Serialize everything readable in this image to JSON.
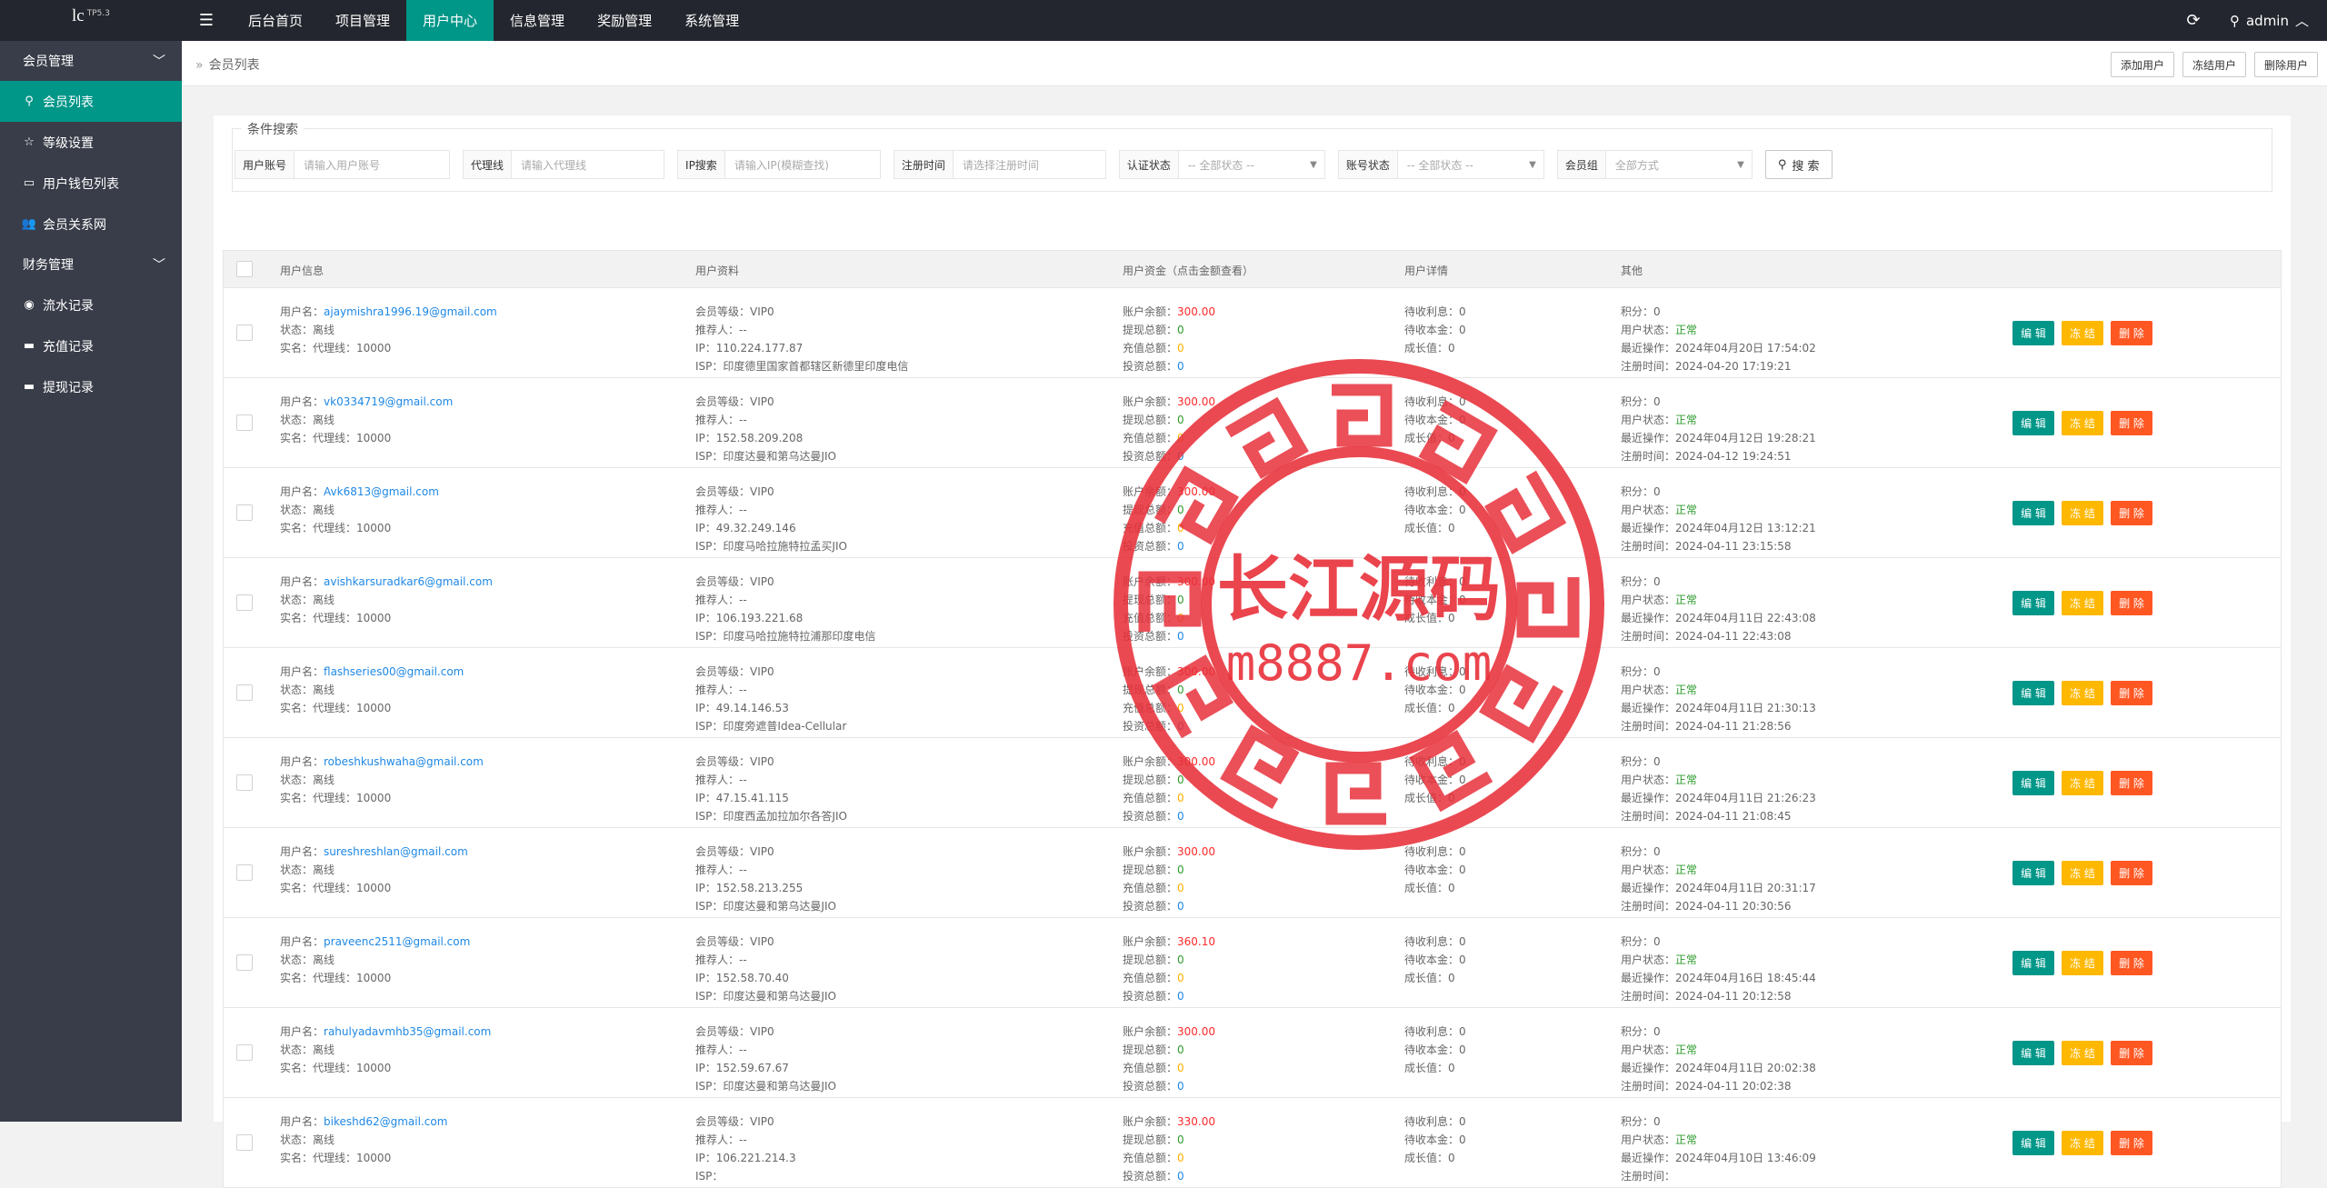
{
  "logo": {
    "main": "lc",
    "sup": "TP5.3"
  },
  "topnav": [
    {
      "label": "后台首页",
      "active": false
    },
    {
      "label": "项目管理",
      "active": false
    },
    {
      "label": "用户中心",
      "active": true
    },
    {
      "label": "信息管理",
      "active": false
    },
    {
      "label": "奖励管理",
      "active": false
    },
    {
      "label": "系统管理",
      "active": false
    }
  ],
  "admin": {
    "name": "admin"
  },
  "sidebar": {
    "group1": "会员管理",
    "items1": [
      {
        "label": "会员列表",
        "icon": "user-icon",
        "glyph": "⚲"
      },
      {
        "label": "等级设置",
        "icon": "star-icon",
        "glyph": "☆"
      },
      {
        "label": "用户钱包列表",
        "icon": "wallet-icon",
        "glyph": "▭"
      },
      {
        "label": "会员关系网",
        "icon": "users-icon",
        "glyph": "👥"
      }
    ],
    "group2": "财务管理",
    "items2": [
      {
        "label": "流水记录",
        "icon": "record-icon",
        "glyph": "◉"
      },
      {
        "label": "充值记录",
        "icon": "card-icon",
        "glyph": "▬"
      },
      {
        "label": "提现记录",
        "icon": "withdraw-icon",
        "glyph": "▬"
      }
    ]
  },
  "breadcrumb": {
    "sep": "»",
    "title": "会员列表"
  },
  "top_buttons": {
    "add": "添加用户",
    "freeze": "冻结用户",
    "delete": "删除用户"
  },
  "search": {
    "legend": "条件搜索",
    "username": {
      "label": "用户账号",
      "placeholder": "请输入用户账号"
    },
    "agent": {
      "label": "代理线",
      "placeholder": "请输入代理线"
    },
    "ip": {
      "label": "IP搜索",
      "placeholder": "请输入IP(模糊查找)"
    },
    "regtime": {
      "label": "注册时间",
      "placeholder": "请选择注册时间"
    },
    "auth": {
      "label": "认证状态",
      "value": "-- 全部状态 --"
    },
    "account": {
      "label": "账号状态",
      "value": "-- 全部状态 --"
    },
    "group": {
      "label": "会员组",
      "value": "全部方式"
    },
    "button": "搜 索"
  },
  "table": {
    "headers": {
      "info": "用户信息",
      "profile": "用户资料",
      "funds": "用户资金（点击金额查看）",
      "detail": "用户详情",
      "other": "其他"
    },
    "labels": {
      "username": "用户名：",
      "status": "状态：",
      "realname": "实名：",
      "agentline": "代理线：",
      "level": "会员等级：",
      "referrer": "推荐人：",
      "ip": "IP：",
      "isp": "ISP：",
      "balance": "账户余额：",
      "withdraw": "提现总额：",
      "recharge": "充值总额：",
      "invest": "投资总额：",
      "pending_interest": "待收利息：",
      "pending_principal": "待收本金：",
      "growth": "成长值：",
      "points": "积分：",
      "user_status": "用户状态：",
      "last_op": "最近操作：",
      "reg_time": "注册时间："
    },
    "ops": {
      "edit": "编 辑",
      "freeze": "冻 结",
      "delete": "删 除"
    },
    "rows": [
      {
        "username": "ajaymishra1996.19@gmail.com",
        "status": "离线",
        "agentline": "10000",
        "level": "VIP0",
        "referrer": "--",
        "ip": "110.224.177.87",
        "isp": "印度德里国家首都辖区新德里印度电信",
        "balance": "300.00",
        "withdraw": "0",
        "recharge": "0",
        "invest": "0",
        "pending_interest": "0",
        "pending_principal": "0",
        "growth": "0",
        "points": "0",
        "user_status": "正常",
        "last_op": "2024年04月20日 17:54:02",
        "reg_time": "2024-04-20 17:19:21"
      },
      {
        "username": "vk0334719@gmail.com",
        "status": "离线",
        "agentline": "10000",
        "level": "VIP0",
        "referrer": "--",
        "ip": "152.58.209.208",
        "isp": "印度达曼和第乌达曼JIO",
        "balance": "300.00",
        "withdraw": "0",
        "recharge": "0",
        "invest": "0",
        "pending_interest": "0",
        "pending_principal": "0",
        "growth": "0",
        "points": "0",
        "user_status": "正常",
        "last_op": "2024年04月12日 19:28:21",
        "reg_time": "2024-04-12 19:24:51"
      },
      {
        "username": "Avk6813@gmail.com",
        "status": "离线",
        "agentline": "10000",
        "level": "VIP0",
        "referrer": "--",
        "ip": "49.32.249.146",
        "isp": "印度马哈拉施特拉孟买JIO",
        "balance": "300.00",
        "withdraw": "0",
        "recharge": "0",
        "invest": "0",
        "pending_interest": "0",
        "pending_principal": "0",
        "growth": "0",
        "points": "0",
        "user_status": "正常",
        "last_op": "2024年04月12日 13:12:21",
        "reg_time": "2024-04-11 23:15:58"
      },
      {
        "username": "avishkarsuradkar6@gmail.com",
        "status": "离线",
        "agentline": "10000",
        "level": "VIP0",
        "referrer": "--",
        "ip": "106.193.221.68",
        "isp": "印度马哈拉施特拉浦那印度电信",
        "balance": "300.00",
        "withdraw": "0",
        "recharge": "0",
        "invest": "0",
        "pending_interest": "0",
        "pending_principal": "0",
        "growth": "0",
        "points": "0",
        "user_status": "正常",
        "last_op": "2024年04月11日 22:43:08",
        "reg_time": "2024-04-11 22:43:08"
      },
      {
        "username": "flashseries00@gmail.com",
        "status": "离线",
        "agentline": "10000",
        "level": "VIP0",
        "referrer": "--",
        "ip": "49.14.146.53",
        "isp": "印度旁遮普Idea-Cellular",
        "balance": "300.00",
        "withdraw": "0",
        "recharge": "0",
        "invest": "0",
        "pending_interest": "0",
        "pending_principal": "0",
        "growth": "0",
        "points": "0",
        "user_status": "正常",
        "last_op": "2024年04月11日 21:30:13",
        "reg_time": "2024-04-11 21:28:56"
      },
      {
        "username": "robeshkushwaha@gmail.com",
        "status": "离线",
        "agentline": "10000",
        "level": "VIP0",
        "referrer": "--",
        "ip": "47.15.41.115",
        "isp": "印度西孟加拉加尔各答JIO",
        "balance": "300.00",
        "withdraw": "0",
        "recharge": "0",
        "invest": "0",
        "pending_interest": "0",
        "pending_principal": "0",
        "growth": "0",
        "points": "0",
        "user_status": "正常",
        "last_op": "2024年04月11日 21:26:23",
        "reg_time": "2024-04-11 21:08:45"
      },
      {
        "username": "sureshreshlan@gmail.com",
        "status": "离线",
        "agentline": "10000",
        "level": "VIP0",
        "referrer": "--",
        "ip": "152.58.213.255",
        "isp": "印度达曼和第乌达曼JIO",
        "balance": "300.00",
        "withdraw": "0",
        "recharge": "0",
        "invest": "0",
        "pending_interest": "0",
        "pending_principal": "0",
        "growth": "0",
        "points": "0",
        "user_status": "正常",
        "last_op": "2024年04月11日 20:31:17",
        "reg_time": "2024-04-11 20:30:56"
      },
      {
        "username": "praveenc2511@gmail.com",
        "status": "离线",
        "agentline": "10000",
        "level": "VIP0",
        "referrer": "--",
        "ip": "152.58.70.40",
        "isp": "印度达曼和第乌达曼JIO",
        "balance": "360.10",
        "withdraw": "0",
        "recharge": "0",
        "invest": "0",
        "pending_interest": "0",
        "pending_principal": "0",
        "growth": "0",
        "points": "0",
        "user_status": "正常",
        "last_op": "2024年04月16日 18:45:44",
        "reg_time": "2024-04-11 20:12:58"
      },
      {
        "username": "rahulyadavmhb35@gmail.com",
        "status": "离线",
        "agentline": "10000",
        "level": "VIP0",
        "referrer": "--",
        "ip": "152.59.67.67",
        "isp": "印度达曼和第乌达曼JIO",
        "balance": "300.00",
        "withdraw": "0",
        "recharge": "0",
        "invest": "0",
        "pending_interest": "0",
        "pending_principal": "0",
        "growth": "0",
        "points": "0",
        "user_status": "正常",
        "last_op": "2024年04月11日 20:02:38",
        "reg_time": "2024-04-11 20:02:38"
      },
      {
        "username": "bikeshd62@gmail.com",
        "status": "离线",
        "agentline": "10000",
        "level": "VIP0",
        "referrer": "--",
        "ip": "106.221.214.3",
        "isp": "",
        "balance": "330.00",
        "withdraw": "0",
        "recharge": "0",
        "invest": "0",
        "pending_interest": "0",
        "pending_principal": "0",
        "growth": "0",
        "points": "0",
        "user_status": "正常",
        "last_op": "2024年04月10日 13:46:09",
        "reg_time": ""
      }
    ]
  },
  "watermark": {
    "line1": "长江源码",
    "line2": "m8887.com"
  },
  "colors": {
    "accent": "#009688",
    "topbar": "#23262e",
    "sidebar": "#393d49",
    "freeze": "#ffb800",
    "delete": "#ff5722",
    "stamp": "#e8303a"
  }
}
